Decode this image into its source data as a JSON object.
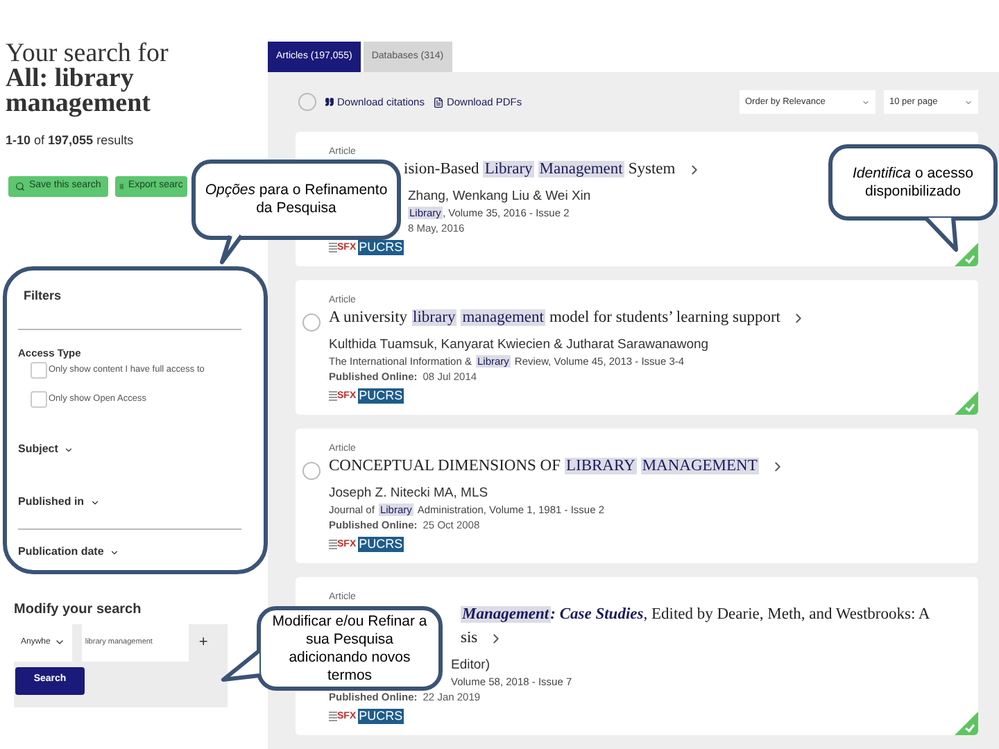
{
  "header": {
    "title_line": "Your search for",
    "query_lines": [
      "All: library",
      "management"
    ],
    "results_count": "**1-10** of **197,055** results"
  },
  "actions": [
    {
      "label": "Save this search",
      "kind": "save"
    },
    {
      "label": "Export searc",
      "kind": "export"
    }
  ],
  "filters": {
    "title": "Filters",
    "access_label": "Access Type",
    "options": [
      {
        "label": "Only show content I have full access to",
        "checked": false
      },
      {
        "label": "Only show Open Access",
        "checked": false
      }
    ],
    "sections": [
      "Subject",
      "Published in",
      "Publication date"
    ]
  },
  "modify": {
    "title": "Modify your search",
    "field": "Anywhe",
    "query": "library management",
    "add": "+",
    "button": "Search"
  },
  "tabs": [
    {
      "label": "Articles (197,055)",
      "selected": true
    },
    {
      "label": "Databases (314)",
      "selected": false
    }
  ],
  "toolbar": {
    "select_all": false,
    "download_citations": "Download citations",
    "download_pdfs": "Download PDFs",
    "sort": "Order by Relevance",
    "per_page": "10 per page"
  },
  "results": [
    {
      "type": "Article",
      "title_lines": [
        [
          {
            "text": "ision-Based",
            "kind": "plain"
          },
          {
            "text": "Library",
            "kind": "term"
          },
          {
            "text": "Management",
            "kind": "term"
          },
          {
            "text": "System",
            "kind": "plain"
          }
        ]
      ],
      "authors": "Zhang, Wenkang Liu & Wei Xin",
      "journal": [
        {
          "text": "Library",
          "kind": "term"
        },
        {
          "text": ", Volume 35, 2016 - Issue 2",
          "kind": "plain"
        }
      ],
      "published_date": "8 May, 2016",
      "sfx": "SFX",
      "library": "PUCRS",
      "full_access": true
    },
    {
      "type": "Article",
      "title_lines": [
        [
          {
            "text": "A university",
            "kind": "plain"
          },
          {
            "text": "library",
            "kind": "term"
          },
          {
            "text": "management",
            "kind": "term"
          },
          {
            "text": "model for students’ learning support",
            "kind": "plain"
          }
        ]
      ],
      "authors": "Kulthida Tuamsuk, Kanyarat Kwiecien & Jutharat Sarawanawong",
      "journal": [
        {
          "text": "The International Information &",
          "kind": "plain"
        },
        {
          "text": "Library",
          "kind": "term"
        },
        {
          "text": "Review, Volume 45, 2013 - Issue 3-4",
          "kind": "plain"
        }
      ],
      "published_label": "Published Online:",
      "published_date": "08 Jul 2014",
      "sfx": "SFX",
      "library": "PUCRS",
      "full_access": true,
      "selected": false
    },
    {
      "type": "Article",
      "title_lines": [
        [
          {
            "text": "CONCEPTUAL DIMENSIONS OF",
            "kind": "plain"
          },
          {
            "text": "LIBRARY",
            "kind": "term"
          },
          {
            "text": "MANAGEMENT",
            "kind": "term"
          }
        ]
      ],
      "authors": "Joseph Z. Nitecki MA, MLS",
      "journal": [
        {
          "text": "Journal of",
          "kind": "plain"
        },
        {
          "text": "Library",
          "kind": "term"
        },
        {
          "text": "Administration, Volume 1, 1981 - Issue 2",
          "kind": "plain"
        }
      ],
      "published_label": "Published Online:",
      "published_date": "25 Oct 2008",
      "sfx": "SFX",
      "library": "PUCRS",
      "full_access": false,
      "selected": false
    },
    {
      "type": "Article",
      "title_lines": [
        [
          {
            "text": "Management",
            "kind": "term_emphasis"
          },
          {
            "text": ": Case Studies",
            "kind": "emphasis"
          },
          {
            "text": ", Edited by Dearie, Meth, and Westbrooks: A",
            "kind": "plain"
          }
        ],
        [
          {
            "text": "sis",
            "kind": "plain"
          }
        ]
      ],
      "authors": "Editor)",
      "journal": [
        {
          "text": "Volume 58, 2018 - Issue 7",
          "kind": "plain"
        }
      ],
      "published_label": "Published Online:",
      "published_date": "22 Jan 2019",
      "sfx": "SFX",
      "library": "PUCRS",
      "full_access": true
    }
  ],
  "callouts": [
    {
      "text": "*Opções* para o Refinamento da Pesquisa"
    },
    {
      "text": "Modificar e/ou Refinar a sua Pesquisa adicionando novos termos"
    },
    {
      "text": "*Identifica* o acesso disponibilizado"
    }
  ]
}
